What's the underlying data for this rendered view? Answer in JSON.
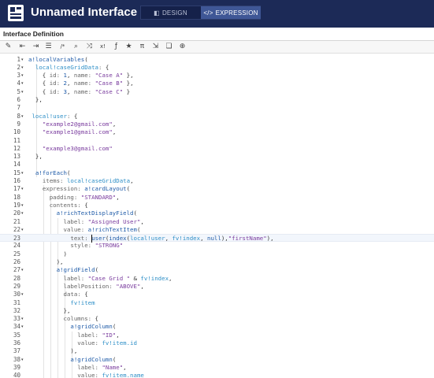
{
  "header": {
    "title": "Unnamed Interface",
    "design_label": "DESIGN",
    "expression_label": "EXPRESSION",
    "active_mode": "expression"
  },
  "subheader": {
    "title": "Interface Definition"
  },
  "toolbar": {
    "buttons": [
      {
        "name": "format-icon",
        "glyph": "✎"
      },
      {
        "name": "indent-decrease-icon",
        "glyph": "⇤"
      },
      {
        "name": "indent-increase-icon",
        "glyph": "⇥"
      },
      {
        "name": "list-icon",
        "glyph": "☰"
      },
      {
        "name": "comment-icon",
        "glyph": "/*"
      },
      {
        "name": "search-icon",
        "glyph": "⌕"
      },
      {
        "name": "shuffle-icon",
        "glyph": "⤨"
      },
      {
        "name": "x-bang-icon",
        "glyph": "x!"
      },
      {
        "name": "function-icon",
        "glyph": "ƒ"
      },
      {
        "name": "star-icon",
        "glyph": "★"
      },
      {
        "name": "pi-icon",
        "glyph": "π"
      },
      {
        "name": "export-icon",
        "glyph": "⇲"
      },
      {
        "name": "copy-icon",
        "glyph": "❏"
      },
      {
        "name": "search-replace-icon",
        "glyph": "⊕"
      }
    ]
  },
  "editor": {
    "current_line": 23,
    "lines": [
      {
        "n": "1",
        "fold": "▾",
        "tokens": [
          [
            "fn",
            "a!localVariables"
          ],
          [
            "p",
            "("
          ]
        ]
      },
      {
        "n": "2",
        "fold": "▾",
        "tokens": [
          [
            "p",
            "  "
          ],
          [
            "var",
            "local!caseGridData"
          ],
          [
            "key",
            ": "
          ],
          [
            "p",
            "{"
          ]
        ]
      },
      {
        "n": "3",
        "fold": "▾",
        "tokens": [
          [
            "p",
            "    { "
          ],
          [
            "key",
            "id: "
          ],
          [
            "num",
            "1"
          ],
          [
            "p",
            ", "
          ],
          [
            "key",
            "name: "
          ],
          [
            "str",
            "\"Case A\""
          ],
          [
            "p",
            " },"
          ]
        ]
      },
      {
        "n": "4",
        "fold": "▾",
        "tokens": [
          [
            "p",
            "    { "
          ],
          [
            "key",
            "id: "
          ],
          [
            "num",
            "2"
          ],
          [
            "p",
            ", "
          ],
          [
            "key",
            "name: "
          ],
          [
            "str",
            "\"Case B\""
          ],
          [
            "p",
            " },"
          ]
        ]
      },
      {
        "n": "5",
        "fold": "▾",
        "tokens": [
          [
            "p",
            "    { "
          ],
          [
            "key",
            "id: "
          ],
          [
            "num",
            "3"
          ],
          [
            "p",
            ", "
          ],
          [
            "key",
            "name: "
          ],
          [
            "str",
            "\"Case C\""
          ],
          [
            "p",
            " }"
          ]
        ]
      },
      {
        "n": "6",
        "fold": "",
        "tokens": [
          [
            "p",
            "  },"
          ]
        ]
      },
      {
        "n": "7",
        "fold": "",
        "tokens": []
      },
      {
        "n": "8",
        "fold": "▾",
        "tokens": [
          [
            "p",
            " "
          ],
          [
            "var",
            "local!user"
          ],
          [
            "key",
            ": "
          ],
          [
            "p",
            "{"
          ]
        ]
      },
      {
        "n": "9",
        "fold": "",
        "tokens": [
          [
            "p",
            "    "
          ],
          [
            "str",
            "\"example2@gmail.com\""
          ],
          [
            "p",
            ","
          ]
        ]
      },
      {
        "n": "10",
        "fold": "",
        "tokens": [
          [
            "p",
            "    "
          ],
          [
            "str",
            "\"example1@gmail.com\""
          ],
          [
            "p",
            ","
          ]
        ]
      },
      {
        "n": "11",
        "fold": "",
        "tokens": []
      },
      {
        "n": "12",
        "fold": "",
        "tokens": [
          [
            "p",
            "    "
          ],
          [
            "str",
            "\"example3@gmail.com\""
          ]
        ]
      },
      {
        "n": "13",
        "fold": "",
        "tokens": [
          [
            "p",
            "  },"
          ]
        ]
      },
      {
        "n": "14",
        "fold": "",
        "tokens": []
      },
      {
        "n": "15",
        "fold": "▾",
        "tokens": [
          [
            "p",
            "  "
          ],
          [
            "fn",
            "a!forEach"
          ],
          [
            "p",
            "("
          ]
        ]
      },
      {
        "n": "16",
        "fold": "",
        "tokens": [
          [
            "p",
            "    "
          ],
          [
            "key",
            "items: "
          ],
          [
            "var",
            "local!caseGridData"
          ],
          [
            "p",
            ","
          ]
        ]
      },
      {
        "n": "17",
        "fold": "▾",
        "tokens": [
          [
            "p",
            "    "
          ],
          [
            "key",
            "expression: "
          ],
          [
            "fn",
            "a!cardLayout"
          ],
          [
            "p",
            "("
          ]
        ]
      },
      {
        "n": "18",
        "fold": "",
        "tokens": [
          [
            "p",
            "      "
          ],
          [
            "key",
            "padding: "
          ],
          [
            "str",
            "\"STANDARD\""
          ],
          [
            "p",
            ","
          ]
        ]
      },
      {
        "n": "19",
        "fold": "▾",
        "tokens": [
          [
            "p",
            "      "
          ],
          [
            "key",
            "contents: "
          ],
          [
            "p",
            "{"
          ]
        ]
      },
      {
        "n": "20",
        "fold": "▾",
        "tokens": [
          [
            "p",
            "        "
          ],
          [
            "fn",
            "a!richTextDisplayField"
          ],
          [
            "p",
            "("
          ]
        ]
      },
      {
        "n": "21",
        "fold": "",
        "tokens": [
          [
            "p",
            "          "
          ],
          [
            "key",
            "label: "
          ],
          [
            "str",
            "\"Assigned User\""
          ],
          [
            "p",
            ","
          ]
        ]
      },
      {
        "n": "22",
        "fold": "▾",
        "tokens": [
          [
            "p",
            "          "
          ],
          [
            "key",
            "value: "
          ],
          [
            "fn",
            "a!richTextItem"
          ],
          [
            "p",
            "("
          ]
        ]
      },
      {
        "n": "23",
        "fold": "",
        "tokens": [
          [
            "p",
            "            "
          ],
          [
            "key",
            "text: "
          ],
          [
            "fn",
            "user"
          ],
          [
            "p",
            "("
          ],
          [
            "fn",
            "index"
          ],
          [
            "p",
            "("
          ],
          [
            "var",
            "local!user"
          ],
          [
            "p",
            ", "
          ],
          [
            "var",
            "fv!index"
          ],
          [
            "p",
            ", "
          ],
          [
            "fn",
            "null"
          ],
          [
            "p",
            "),"
          ],
          [
            "str",
            "\"firstName\""
          ],
          [
            "p",
            "),"
          ]
        ]
      },
      {
        "n": "24",
        "fold": "",
        "tokens": [
          [
            "p",
            "            "
          ],
          [
            "key",
            "style: "
          ],
          [
            "str",
            "\"STRONG\""
          ]
        ]
      },
      {
        "n": "25",
        "fold": "",
        "tokens": [
          [
            "p",
            "          )"
          ]
        ]
      },
      {
        "n": "26",
        "fold": "",
        "tokens": [
          [
            "p",
            "        ),"
          ]
        ]
      },
      {
        "n": "27",
        "fold": "▾",
        "tokens": [
          [
            "p",
            "        "
          ],
          [
            "fn",
            "a!gridField"
          ],
          [
            "p",
            "("
          ]
        ]
      },
      {
        "n": "28",
        "fold": "",
        "tokens": [
          [
            "p",
            "          "
          ],
          [
            "key",
            "label: "
          ],
          [
            "str",
            "\"Case Grid \""
          ],
          [
            "p",
            " & "
          ],
          [
            "var",
            "fv!index"
          ],
          [
            "p",
            ","
          ]
        ]
      },
      {
        "n": "29",
        "fold": "",
        "tokens": [
          [
            "p",
            "          "
          ],
          [
            "key",
            "labelPosition: "
          ],
          [
            "str",
            "\"ABOVE\""
          ],
          [
            "p",
            ","
          ]
        ]
      },
      {
        "n": "30",
        "fold": "▾",
        "tokens": [
          [
            "p",
            "          "
          ],
          [
            "key",
            "data: "
          ],
          [
            "p",
            "{"
          ]
        ]
      },
      {
        "n": "31",
        "fold": "",
        "tokens": [
          [
            "p",
            "            "
          ],
          [
            "var",
            "fv!item"
          ]
        ]
      },
      {
        "n": "32",
        "fold": "",
        "tokens": [
          [
            "p",
            "          },"
          ]
        ]
      },
      {
        "n": "33",
        "fold": "▾",
        "tokens": [
          [
            "p",
            "          "
          ],
          [
            "key",
            "columns: "
          ],
          [
            "p",
            "{"
          ]
        ]
      },
      {
        "n": "34",
        "fold": "▾",
        "tokens": [
          [
            "p",
            "            "
          ],
          [
            "fn",
            "a!gridColumn"
          ],
          [
            "p",
            "("
          ]
        ]
      },
      {
        "n": "35",
        "fold": "",
        "tokens": [
          [
            "p",
            "              "
          ],
          [
            "key",
            "label: "
          ],
          [
            "str",
            "\"ID\""
          ],
          [
            "p",
            ","
          ]
        ]
      },
      {
        "n": "36",
        "fold": "",
        "tokens": [
          [
            "p",
            "              "
          ],
          [
            "key",
            "value: "
          ],
          [
            "var",
            "fv!item.id"
          ]
        ]
      },
      {
        "n": "37",
        "fold": "",
        "tokens": [
          [
            "p",
            "            ),"
          ]
        ]
      },
      {
        "n": "38",
        "fold": "▾",
        "tokens": [
          [
            "p",
            "            "
          ],
          [
            "fn",
            "a!gridColumn"
          ],
          [
            "p",
            "("
          ]
        ]
      },
      {
        "n": "39",
        "fold": "",
        "tokens": [
          [
            "p",
            "              "
          ],
          [
            "key",
            "label: "
          ],
          [
            "str",
            "\"Name\""
          ],
          [
            "p",
            ","
          ]
        ]
      },
      {
        "n": "40",
        "fold": "",
        "tokens": [
          [
            "p",
            "              "
          ],
          [
            "key",
            "value: "
          ],
          [
            "var",
            "fv!item.name"
          ]
        ]
      }
    ]
  }
}
